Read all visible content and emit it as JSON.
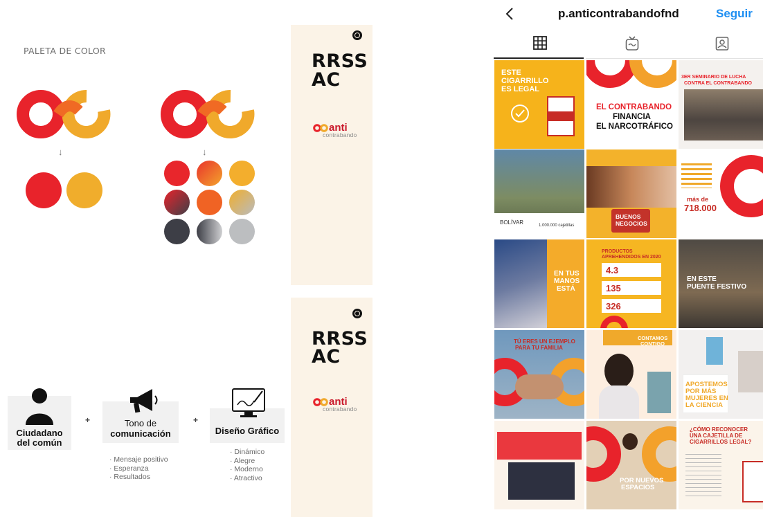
{
  "palette": {
    "title": "PALETA DE COLOR",
    "arrow": "↓",
    "colors": {
      "red": "#e8232b",
      "orange": "#f0a92b",
      "dark": "#3d3e46",
      "gray": "#b9bbbd"
    }
  },
  "panels": [
    {
      "title_line1": "RRSS",
      "title_line2": "AC",
      "logo_word": "anti",
      "logo_sub": "contrabando"
    },
    {
      "title_line1": "RRSS",
      "title_line2": "AC",
      "logo_word": "anti",
      "logo_sub": "contrabando"
    }
  ],
  "concept": {
    "plus": "+",
    "cards": [
      {
        "label_line1": "Ciudadano",
        "label_line2": "del común",
        "icon": "person-icon"
      },
      {
        "label_line1": "Tono de",
        "label_line2": "comunicación",
        "icon": "megaphone-icon"
      },
      {
        "label_line1": "Diseño Gráfico",
        "label_line2": "",
        "icon": "monitor-pen-icon"
      }
    ],
    "tone_items": [
      "· Mensaje positivo",
      "· Esperanza",
      "· Resultados"
    ],
    "design_items": [
      "· Dinámico",
      "· Alegre",
      "· Moderno",
      "· Atractivo"
    ]
  },
  "instagram": {
    "back_icon": "chevron-left-icon",
    "username": "p.anticontrabandofnd",
    "follow_label": "Seguir",
    "tabs": [
      "grid-icon",
      "igtv-icon",
      "tagged-icon"
    ],
    "posts": [
      {
        "l1": "ESTE",
        "l2": "CIGARRILLO",
        "l3": "ES LEGAL"
      },
      {
        "l1": "EL CONTRABANDO",
        "l2": "FINANCIA",
        "l3": "EL NARCOTRÁFICO"
      },
      {
        "l1": "3ER SEMINARIO DE LUCHA",
        "l2": "CONTRA EL CONTRABANDO",
        "l3": ""
      },
      {
        "l1": "BOLÍVAR",
        "l2": "1.000.000 cajetillas",
        "l3": ""
      },
      {
        "l1": "BUENOS",
        "l2": "NEGOCIOS",
        "l3": ""
      },
      {
        "l1": "más de",
        "l2": "718.000",
        "l3": ""
      },
      {
        "l1": "EN TUS",
        "l2": "MANOS",
        "l3": "ESTÁ"
      },
      {
        "l1": "PRODUCTOS",
        "l2": "APREHENDIDOS EN 2020",
        "l3": "4.3",
        "l4": "135",
        "l5": "326"
      },
      {
        "l1": "EN ESTE",
        "l2": "PUENTE FESTIVO",
        "l3": ""
      },
      {
        "l1": "TÚ ERES UN EJEMPLO",
        "l2": "PARA TU FAMILIA",
        "l3": ""
      },
      {
        "l1": "CONTAMOS",
        "l2": "CONTIGO",
        "l3": ""
      },
      {
        "l1": "APOSTEMOS",
        "l2": "POR MÁS",
        "l3": "MUJERES EN",
        "l4": "LA CIENCIA"
      },
      {
        "l1": "",
        "l2": "",
        "l3": ""
      },
      {
        "l1": "POR NUEVOS",
        "l2": "ESPACIOS",
        "l3": ""
      },
      {
        "l1": "¿CÓMO RECONOCER",
        "l2": "UNA CAJETILLA DE",
        "l3": "CIGARRILLOS LEGAL?"
      }
    ]
  }
}
